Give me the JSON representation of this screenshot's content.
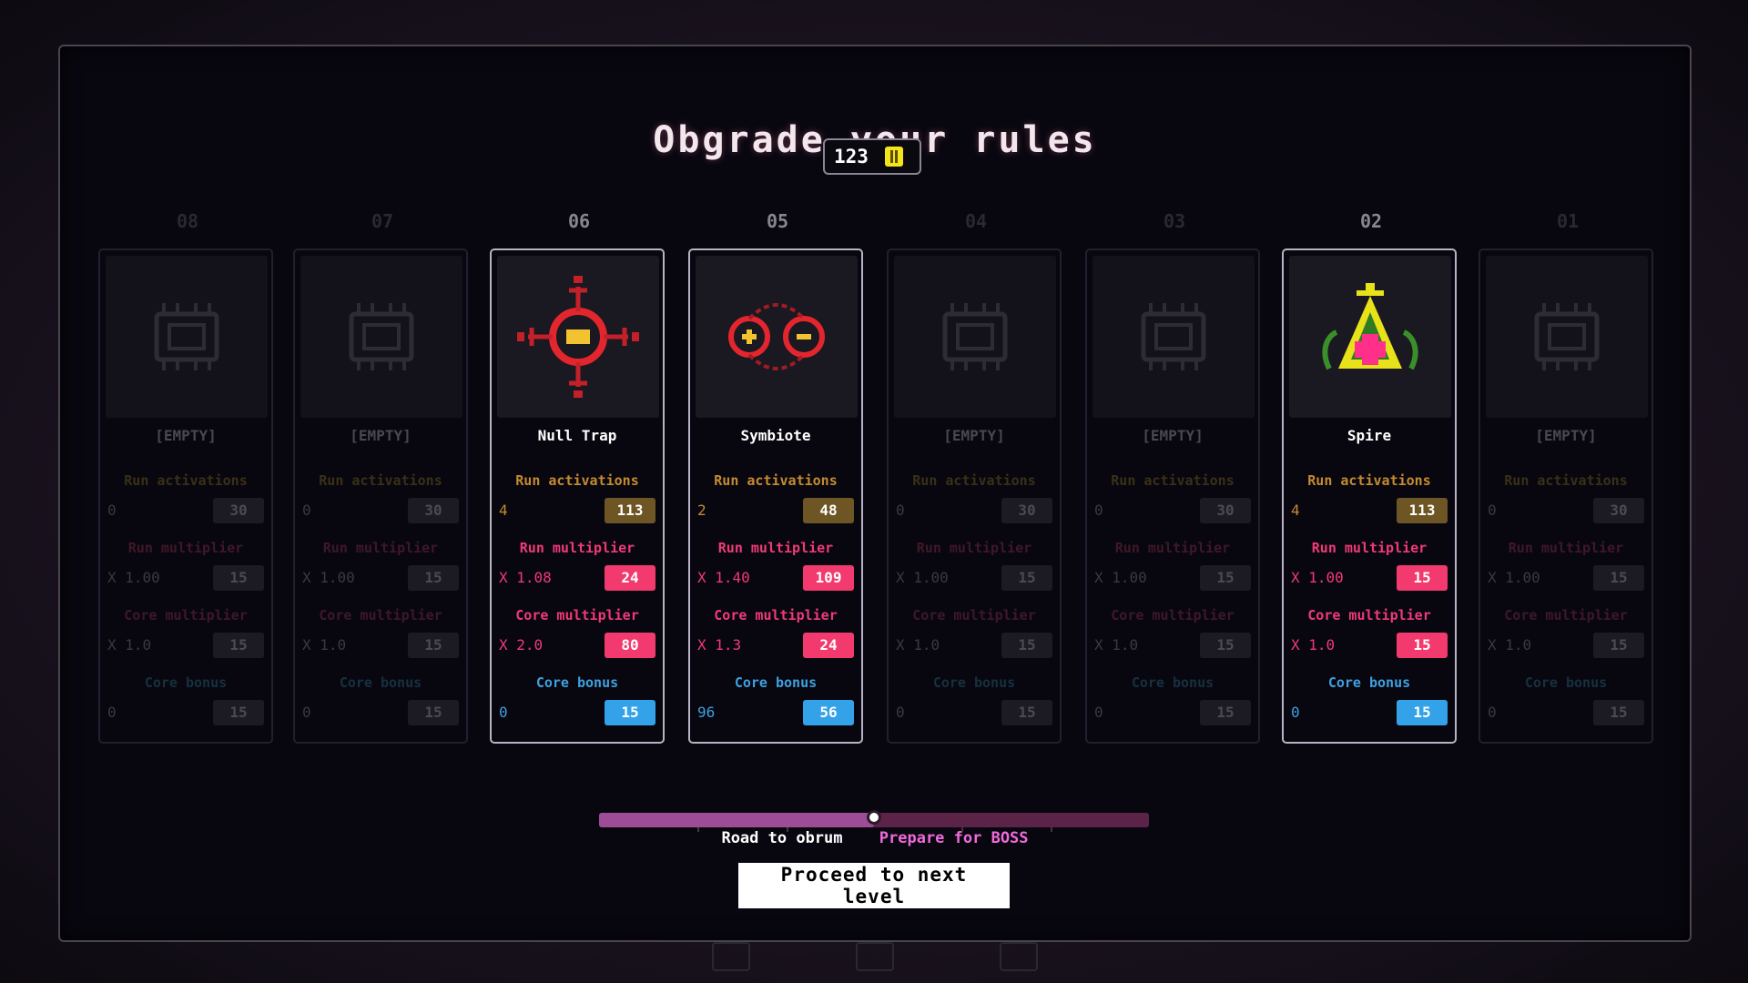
{
  "title": "Obgrade your rules",
  "currency": {
    "amount": "123",
    "icon": "coin-icon"
  },
  "labels": {
    "run_activations": "Run activations",
    "run_multiplier": "Run multiplier",
    "core_multiplier": "Core multiplier",
    "core_bonus": "Core bonus"
  },
  "slots": [
    {
      "num": "08",
      "name": "[EMPTY]",
      "icon": "chip-icon",
      "act": "0",
      "act_cost": "30",
      "rm": "X 1.00",
      "rm_cost": "15",
      "cm": "X 1.0",
      "cm_cost": "15",
      "cb": "0",
      "cb_cost": "15"
    },
    {
      "num": "07",
      "name": "[EMPTY]",
      "icon": "chip-icon",
      "act": "0",
      "act_cost": "30",
      "rm": "X 1.00",
      "rm_cost": "15",
      "cm": "X 1.0",
      "cm_cost": "15",
      "cb": "0",
      "cb_cost": "15"
    },
    {
      "num": "06",
      "name": "Null Trap",
      "icon": "null-trap-icon",
      "act": "4",
      "act_cost": "113",
      "rm": "X 1.08",
      "rm_cost": "24",
      "cm": "X 2.0",
      "cm_cost": "80",
      "cb": "0",
      "cb_cost": "15"
    },
    {
      "num": "05",
      "name": "Symbiote",
      "icon": "symbiote-icon",
      "act": "2",
      "act_cost": "48",
      "rm": "X 1.40",
      "rm_cost": "109",
      "cm": "X 1.3",
      "cm_cost": "24",
      "cb": "96",
      "cb_cost": "56"
    },
    {
      "num": "04",
      "name": "[EMPTY]",
      "icon": "chip-icon",
      "act": "0",
      "act_cost": "30",
      "rm": "X 1.00",
      "rm_cost": "15",
      "cm": "X 1.0",
      "cm_cost": "15",
      "cb": "0",
      "cb_cost": "15"
    },
    {
      "num": "03",
      "name": "[EMPTY]",
      "icon": "chip-icon",
      "act": "0",
      "act_cost": "30",
      "rm": "X 1.00",
      "rm_cost": "15",
      "cm": "X 1.0",
      "cm_cost": "15",
      "cb": "0",
      "cb_cost": "15"
    },
    {
      "num": "02",
      "name": "Spire",
      "icon": "spire-icon",
      "act": "4",
      "act_cost": "113",
      "rm": "X 1.00",
      "rm_cost": "15",
      "cm": "X 1.0",
      "cm_cost": "15",
      "cb": "0",
      "cb_cost": "15"
    },
    {
      "num": "01",
      "name": "[EMPTY]",
      "icon": "chip-icon",
      "act": "0",
      "act_cost": "30",
      "rm": "X 1.00",
      "rm_cost": "15",
      "cm": "X 1.0",
      "cm_cost": "15",
      "cb": "0",
      "cb_cost": "15"
    }
  ],
  "road": {
    "label_a": "Road to obrum",
    "label_b": "Prepare for BOSS",
    "progress": 0.5
  },
  "proceed_label": "Proceed to next level",
  "colors": {
    "accent_pink": "#f23a6e",
    "accent_blue": "#34a2e8",
    "accent_gold": "#6d5524",
    "coin_yellow": "#f4e51a"
  }
}
